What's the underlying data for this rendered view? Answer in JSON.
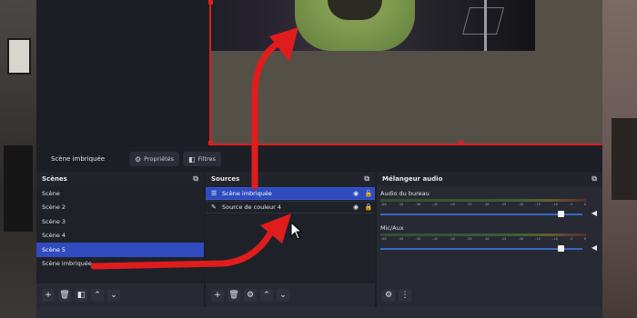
{
  "context_bar": {
    "scene_name": "Scène imbriquée",
    "properties_label": "Propriétés",
    "filters_label": "Filtres"
  },
  "scenes": {
    "title": "Scènes",
    "items": [
      {
        "label": "Scène",
        "selected": false
      },
      {
        "label": "Scène 2",
        "selected": false
      },
      {
        "label": "Scène 3",
        "selected": false
      },
      {
        "label": "Scène 4",
        "selected": false
      },
      {
        "label": "Scène 5",
        "selected": true
      },
      {
        "label": "Scène imbriquée",
        "selected": false
      }
    ],
    "toolbar": [
      "add-icon",
      "trash-icon",
      "filter-icon",
      "chevron-up-icon",
      "chevron-down-icon"
    ]
  },
  "sources": {
    "title": "Sources",
    "items": [
      {
        "label": "Scène imbriquée",
        "icon": "list-icon",
        "selected": true,
        "visible": true,
        "locked": false
      },
      {
        "label": "Source de couleur 4",
        "icon": "brush-icon",
        "selected": false,
        "visible": true,
        "locked": true
      }
    ],
    "toolbar": [
      "add-icon",
      "trash-icon",
      "gear-icon",
      "chevron-up-icon",
      "chevron-down-icon"
    ]
  },
  "mixer": {
    "title": "Mélangeur audio",
    "tracks": [
      {
        "name": "Audio du bureau",
        "volume": 0.88
      },
      {
        "name": "Mic/Aux",
        "volume": 0.88
      }
    ],
    "ticks": [
      "-60",
      "-55",
      "-50",
      "-45",
      "-40",
      "-35",
      "-30",
      "-25",
      "-20",
      "-15",
      "-10",
      "-5",
      "0"
    ],
    "toolbar": [
      "advanced-audio-icon",
      "more-options-icon"
    ]
  },
  "colors": {
    "accent_selection": "#2f4bbf",
    "annotation_red": "#e01c1c",
    "dock_background": "#272a33"
  }
}
